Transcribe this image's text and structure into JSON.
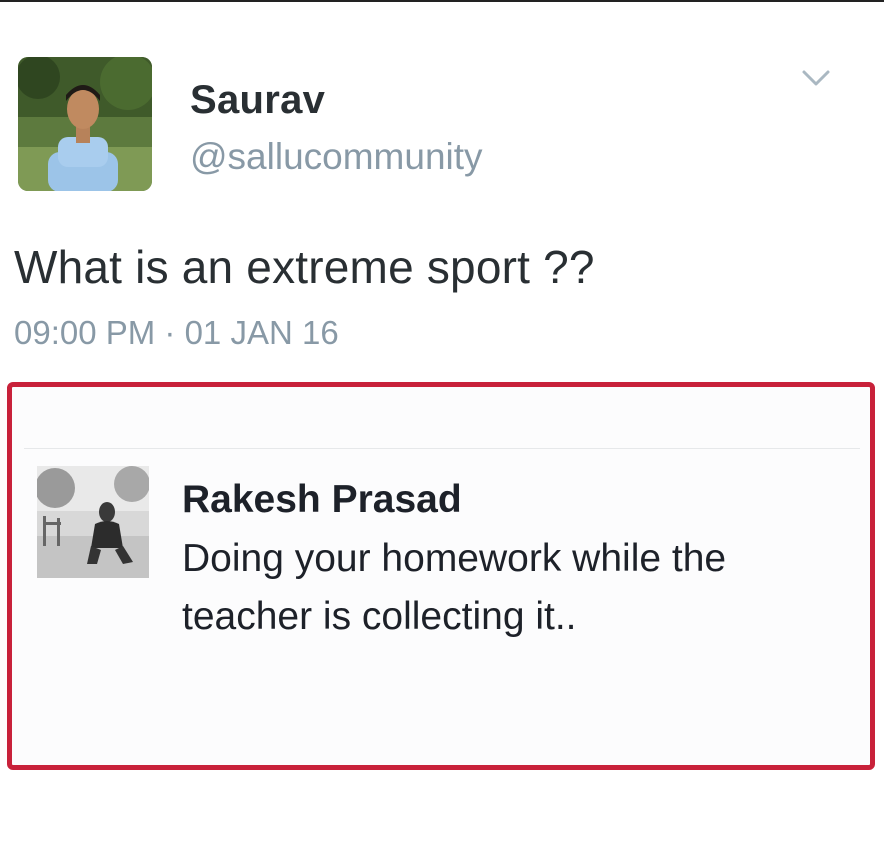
{
  "tweet": {
    "author_name": "Saurav",
    "author_handle": "@sallucommunity",
    "text": "What is an extreme sport ??",
    "timestamp": "09:00 PM · 01 JAN 16",
    "menu_icon": "chevron-down-icon"
  },
  "reply": {
    "author_name": "Rakesh Prasad",
    "text": "Doing your homework while the teacher is collecting it.."
  },
  "colors": {
    "highlight_border": "#c8213a",
    "name_text": "#292f33",
    "secondary_text": "#8899a6"
  }
}
